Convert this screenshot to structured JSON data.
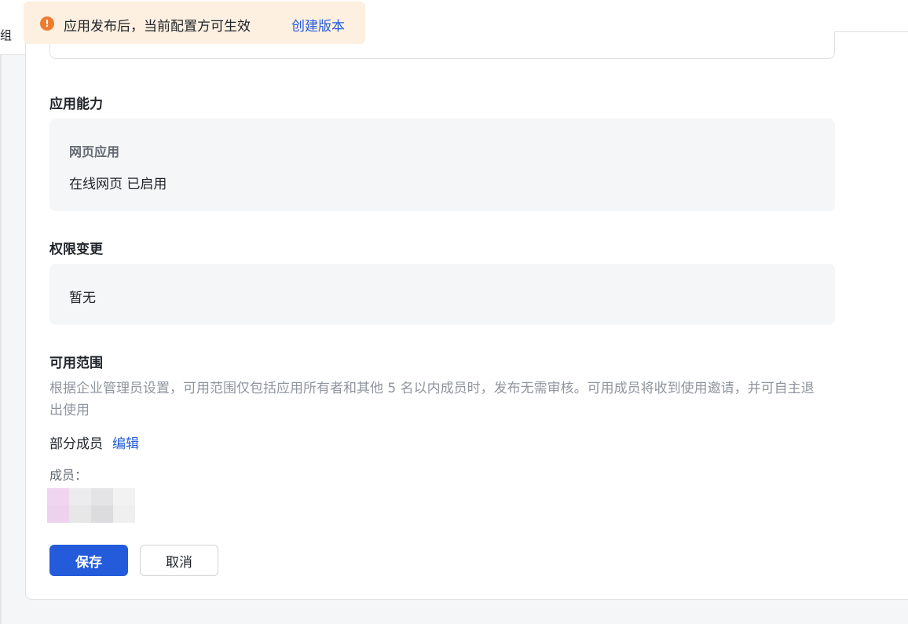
{
  "toast": {
    "message": "应用发布后，当前配置方可生效",
    "action": "创建版本",
    "icon": "warning-circle-icon",
    "accent": "#ed7b2f",
    "background": "#fdf0e1"
  },
  "left_fragment": "组",
  "capability": {
    "title": "应用能力",
    "subtitle": "网页应用",
    "status": "在线网页 已启用"
  },
  "permission": {
    "title": "权限变更",
    "value": "暂无"
  },
  "scope": {
    "title": "可用范围",
    "description": "根据企业管理员设置，可用范围仅包括应用所有者和其他 5 名以内成员时，发布无需审核。可用成员将收到使用邀请，并可自主退出使用",
    "selection": "部分成员",
    "edit_label": "编辑",
    "members_label": "成员："
  },
  "actions": {
    "save_label": "保存",
    "cancel_label": "取消"
  },
  "colors": {
    "primary": "#245bdb",
    "panel_bg": "#f5f6f7",
    "muted_text": "#8f959e"
  }
}
